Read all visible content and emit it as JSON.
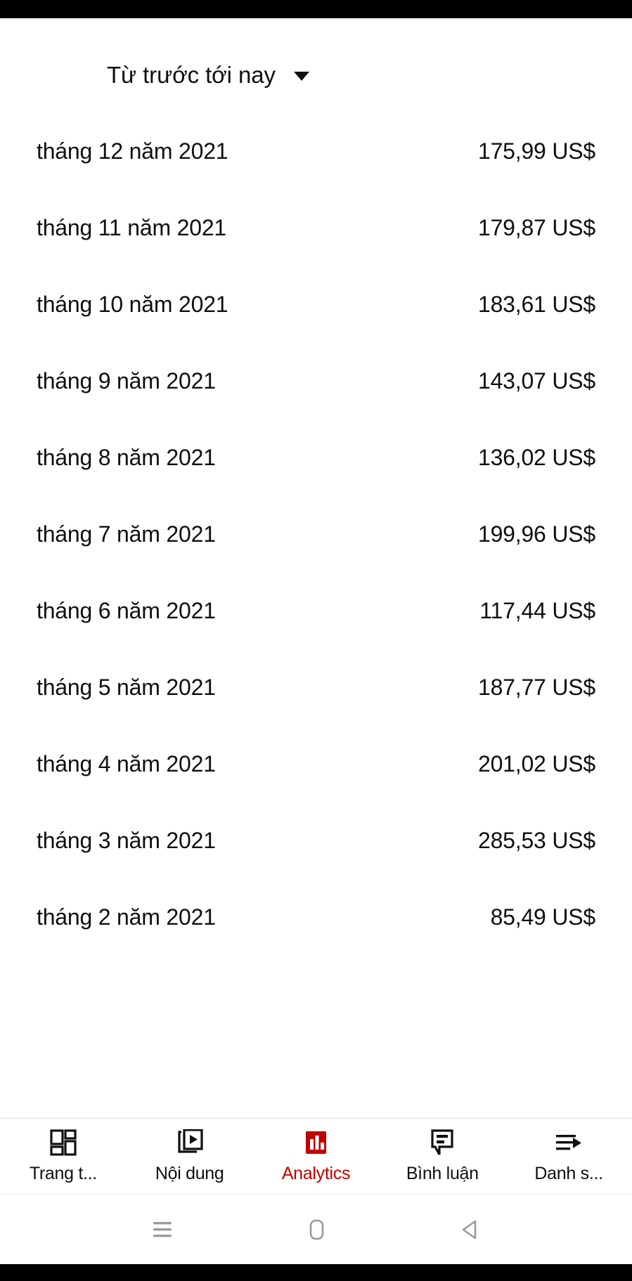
{
  "statusbar": {
    "style": "black"
  },
  "header": {
    "filter_label": "Từ trước tới nay",
    "caret_icon": "chevron-down-icon"
  },
  "list": {
    "rows": [
      {
        "label": "tháng 12 năm 2021",
        "value": "175,99 US$"
      },
      {
        "label": "tháng 11 năm 2021",
        "value": "179,87 US$"
      },
      {
        "label": "tháng 10 năm 2021",
        "value": "183,61 US$"
      },
      {
        "label": "tháng 9 năm 2021",
        "value": "143,07 US$"
      },
      {
        "label": "tháng 8 năm 2021",
        "value": "136,02 US$"
      },
      {
        "label": "tháng 7 năm 2021",
        "value": "199,96 US$"
      },
      {
        "label": "tháng 6 năm 2021",
        "value": "117,44 US$"
      },
      {
        "label": "tháng 5 năm 2021",
        "value": "187,77 US$"
      },
      {
        "label": "tháng 4 năm 2021",
        "value": "201,02 US$"
      },
      {
        "label": "tháng 3 năm 2021",
        "value": "285,53 US$"
      },
      {
        "label": "tháng 2 năm 2021",
        "value": "85,49 US$"
      }
    ]
  },
  "tabbar": {
    "active_color": "#c00000",
    "tabs": [
      {
        "label": "Trang t...",
        "icon": "dashboard-icon",
        "active": false
      },
      {
        "label": "Nội dung",
        "icon": "content-video-icon",
        "active": false
      },
      {
        "label": "Analytics",
        "icon": "analytics-bar-chart-icon",
        "active": true
      },
      {
        "label": "Bình luận",
        "icon": "comment-bubble-icon",
        "active": false
      },
      {
        "label": "Danh s...",
        "icon": "playlist-icon",
        "active": false
      }
    ]
  },
  "navbar": {
    "buttons": [
      {
        "icon": "recents-menu-icon"
      },
      {
        "icon": "home-square-icon"
      },
      {
        "icon": "back-triangle-icon"
      }
    ]
  }
}
